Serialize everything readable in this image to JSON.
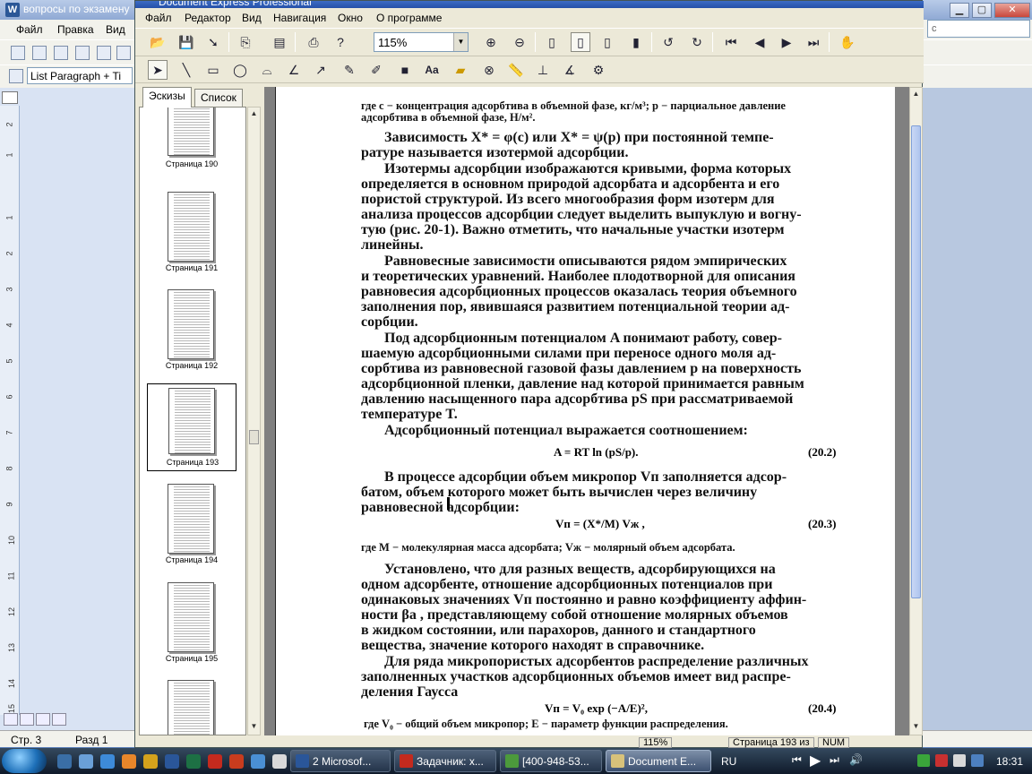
{
  "word": {
    "title": "вопросы по экзамену",
    "menu": [
      "Файл",
      "Правка",
      "Вид"
    ],
    "style_box": "List Paragraph + Ti",
    "search_placeholder": "с",
    "status": {
      "page": "Стр. 3",
      "section": "Разд 1"
    },
    "ruler_numbers": [
      "2",
      "1",
      "1",
      "2",
      "3",
      "4",
      "5",
      "6",
      "7",
      "8",
      "9",
      "10",
      "11",
      "12",
      "13",
      "14",
      "15"
    ]
  },
  "dex": {
    "title": "Document Express Professional",
    "menu": [
      "Файл",
      "Редактор",
      "Вид",
      "Навигация",
      "Окно",
      "О программе"
    ],
    "zoom": "115%",
    "side_tabs": [
      "Эскизы",
      "Список"
    ],
    "thumbnails": [
      "Страница 190",
      "Страница 191",
      "Страница 192",
      "Страница 193",
      "Страница 194",
      "Страница 195"
    ],
    "selected_thumbnail": 3,
    "status": {
      "zoom": "115%",
      "page": "Страница 193 из",
      "num": "NUM"
    }
  },
  "doc": {
    "l0": "где c − концентрация адсорбтива в объемной фазе, кг/м³; p − парциальное давление",
    "l1": "адсорбтива в объемной фазе, Н/м².",
    "p1a": "Зависимость X* = φ(c) или X* = ψ(p) при постоянной темпе-",
    "p1b": "ратуре называется изотермой адсорбции.",
    "p2a": "Изотермы адсорбции изображаются кривыми, форма которых",
    "p2b": "определяется в основном природой адсорбата и адсорбента и его",
    "p2c": "пористой структурой. Из всего многообразия форм изотерм для",
    "p2d": "анализа процессов адсорбции следует выделить выпуклую и вогну-",
    "p2e": "тую (рис. 20-1). Важно отметить, что начальные участки изотерм",
    "p2f": "линейны.",
    "p3a": "Равновесные зависимости описываются рядом эмпирических",
    "p3b": "и теоретических уравнений. Наиболее плодотворной для описания",
    "p3c": "равновесия адсорбционных процессов оказалась теория объемного",
    "p3d": "заполнения пор, явившаяся развитием потенциальной теории ад-",
    "p3e": "сорбции.",
    "p4a": "Под адсорбционным потенциалом A понимают работу, совер-",
    "p4b": "шаемую адсорбционными силами при переносе одного моля ад-",
    "p4c": "сорбтива из равновесной газовой фазы давлением p на поверхность",
    "p4d": "адсорбционной пленки, давление над которой принимается равным",
    "p4e": "давлению насыщенного пара адсорбтива pS при рассматриваемой",
    "p4f": "температуре T.",
    "p5": "Адсорбционный потенциал выражается соотношением:",
    "eq1": "A = RT ln (pS/p).",
    "eq1n": "(20.2)",
    "p6a": "В процессе адсорбции объем микропор Vп заполняется адсор-",
    "p6b": "батом, объем которого может быть вычислен через величину",
    "p6c": "равновесной адсорбции:",
    "eq2": "Vп = (X*/M) Vж ,",
    "eq2n": "(20.3)",
    "l2": "где M − молекулярная масса адсорбата; Vж − молярный объем адсорбата.",
    "p7a": "Установлено, что для разных веществ, адсорбирующихся на",
    "p7b": "одном адсорбенте, отношение адсорбционных потенциалов при",
    "p7c": "одинаковых значениях Vп постоянно и равно коэффициенту аффин-",
    "p7d": "ности βа , представляющему собой отношение молярных объемов",
    "p7e": "в жидком состоянии, или парахоров, данного и стандартного",
    "p7f": "вещества, значение которого находят в справочнике.",
    "p8a": "Для ряда микропористых адсорбентов распределение различных",
    "p8b": "заполненных участков адсорбционных объемов имеет вид распре-",
    "p8c": "деления Гаусса",
    "eq3": "Vп = V₀ exp (−A/E)²,",
    "eq3n": "(20.4)",
    "l3": "где V₀ − общий объем микропор; E − параметр функции распределения."
  },
  "taskbar": {
    "tasks": [
      "2 Microsof...",
      "Задачник: х...",
      "[400-948-53...",
      "Document E..."
    ],
    "active_task": 3,
    "lang": "RU",
    "clock": "18:31"
  }
}
